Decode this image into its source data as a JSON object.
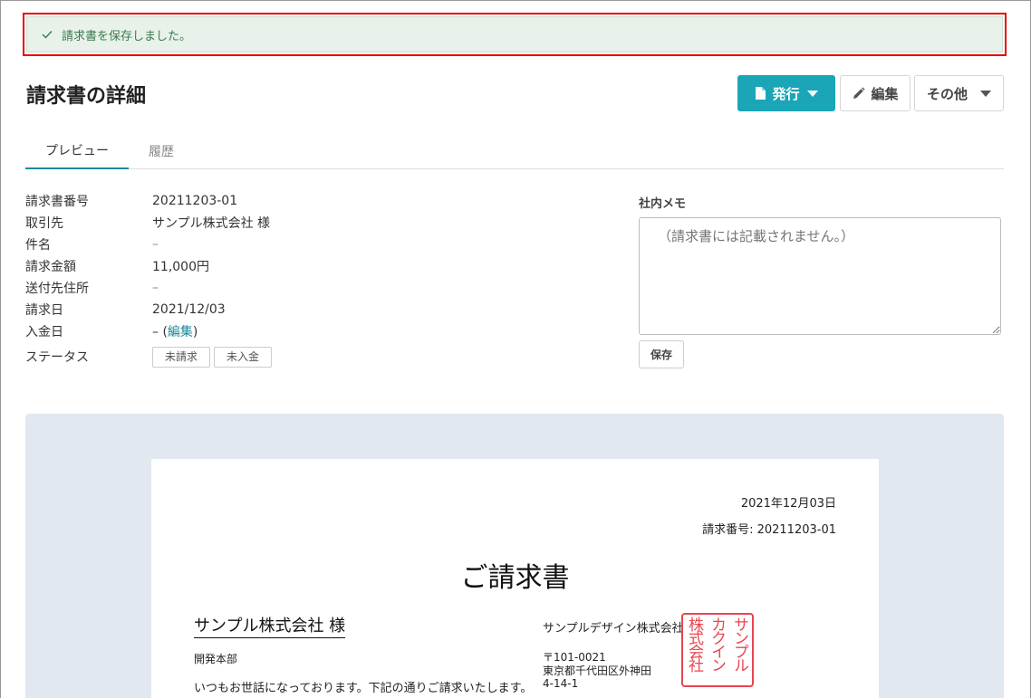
{
  "flash": {
    "message": "請求書を保存しました。"
  },
  "header": {
    "title": "請求書の詳細"
  },
  "actions": {
    "issue_label": "発行",
    "edit_label": "編集",
    "other_label": "その他"
  },
  "tabs": [
    {
      "label": "プレビュー",
      "active": true
    },
    {
      "label": "履歴",
      "active": false
    }
  ],
  "details": {
    "invoice_number": {
      "label": "請求書番号",
      "value": "20211203-01"
    },
    "client": {
      "label": "取引先",
      "value": "サンプル株式会社 様"
    },
    "subject": {
      "label": "件名",
      "value": "–"
    },
    "amount": {
      "label": "請求金額",
      "value": "11,000円"
    },
    "address": {
      "label": "送付先住所",
      "value": "–"
    },
    "invoice_date": {
      "label": "請求日",
      "value": "2021/12/03"
    },
    "payment_date": {
      "label": "入金日",
      "value_prefix": "– (",
      "edit_link": "編集",
      "value_suffix": ")"
    },
    "status": {
      "label": "ステータス",
      "tags": [
        "未請求",
        "未入金"
      ]
    }
  },
  "memo": {
    "label": "社内メモ",
    "placeholder": "（請求書には記載されません。）",
    "save_label": "保存"
  },
  "document": {
    "date": "2021年12月03日",
    "number": "請求番号: 20211203-01",
    "title": "ご請求書",
    "client": "サンプル株式会社 様",
    "department": "開発本部",
    "greeting": "いつもお世話になっております。下記の通りご請求いたします。",
    "issuer": "サンプルデザイン株式会社",
    "postal": "〒101-0021",
    "address_line1": "東京都千代田区外神田",
    "address_line2": "4-14-1",
    "seal_text": [
      "サンプル",
      "カクイン",
      "株式会社"
    ]
  },
  "colors": {
    "accent": "#1aa6b7",
    "link": "#1a8a9a",
    "flash_bg": "#e8f1ea",
    "highlight_border": "#e60000",
    "seal": "#e8454f"
  }
}
